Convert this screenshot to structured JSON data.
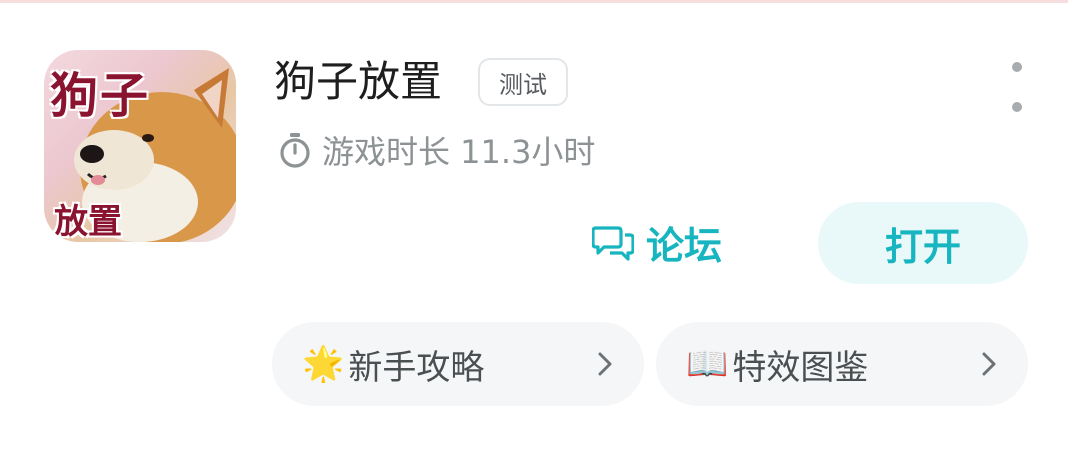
{
  "game": {
    "title": "狗子放置",
    "badge": "测试",
    "icon_title_text": "狗子",
    "icon_sub_text": "放置",
    "playtime": "游戏时长 11.3小时"
  },
  "actions": {
    "forum_label": "论坛",
    "open_label": "打开"
  },
  "shortcuts": [
    {
      "emoji": "🌟",
      "label": "新手攻略"
    },
    {
      "emoji": "📖",
      "label": "特效图鉴"
    }
  ],
  "icons": {
    "more": "more-vertical-icon",
    "timer": "stopwatch-icon",
    "forum": "chat-bubbles-icon",
    "chevron": "chevron-right-icon"
  },
  "colors": {
    "accent": "#17b5bf",
    "accent_bg": "#e9f8f9",
    "text_primary": "#1e1e1e",
    "text_secondary": "#8d9295",
    "pill_bg": "#f5f6f7",
    "icon_text": "#8a1330"
  }
}
